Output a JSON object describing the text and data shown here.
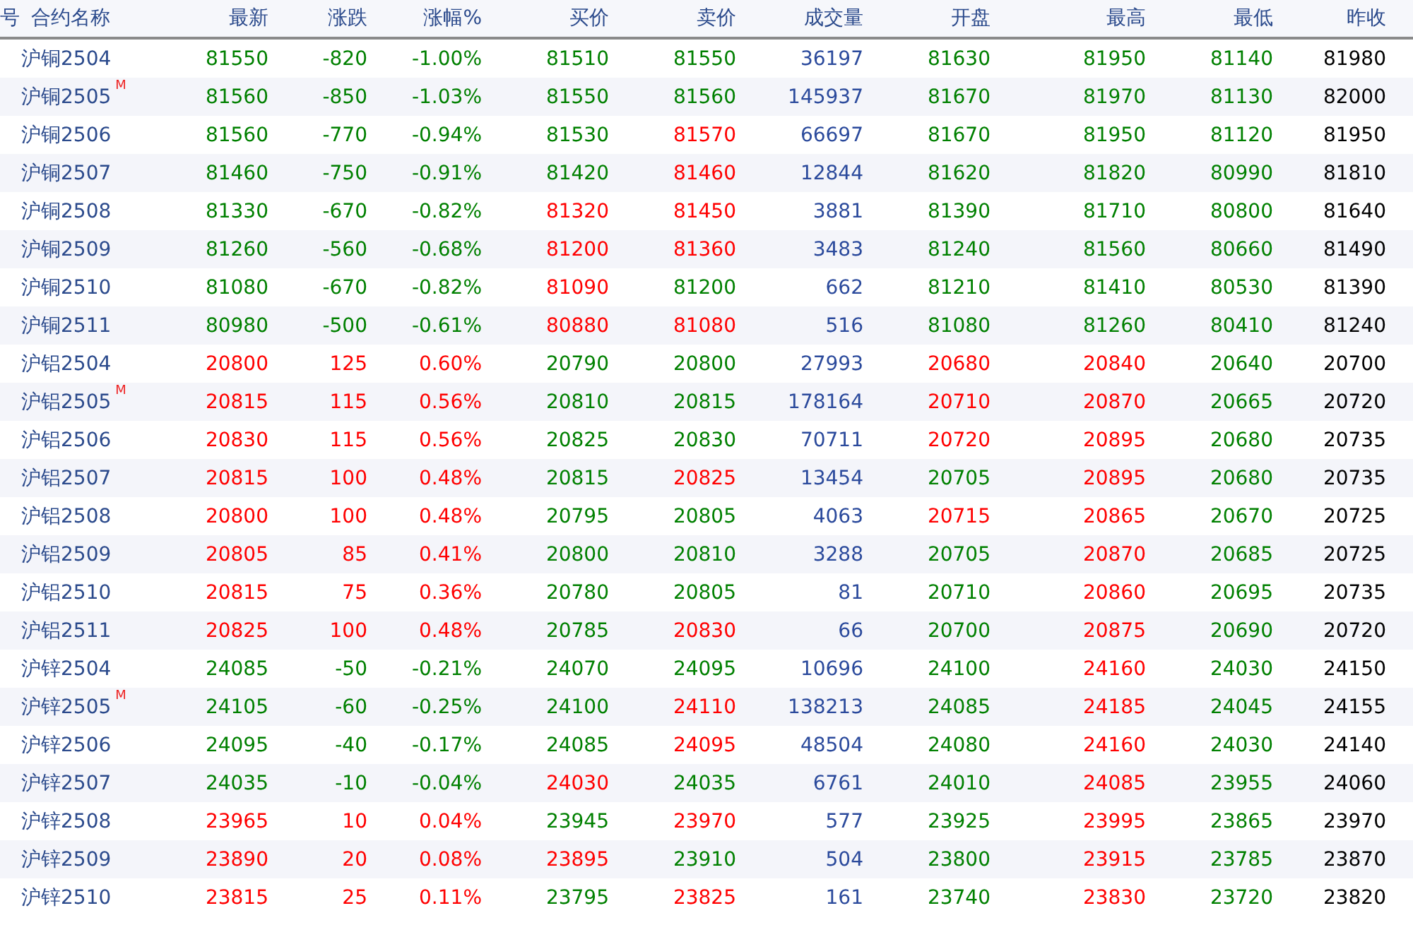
{
  "table": {
    "cut_column_header": "号",
    "columns": [
      "合约名称",
      "最新",
      "涨跌",
      "涨幅%",
      "买价",
      "卖价",
      "成交量",
      "开盘",
      "最高",
      "最低",
      "昨收"
    ],
    "rows": [
      {
        "cells": [
          {
            "text": "沪铜2504"
          },
          {
            "text": "81550",
            "color": "#008000"
          },
          {
            "text": "-820",
            "color": "#008000"
          },
          {
            "text": "-1.00%",
            "color": "#008000"
          },
          {
            "text": "81510",
            "color": "#008000"
          },
          {
            "text": "81550",
            "color": "#008000"
          },
          {
            "text": "36197",
            "color": "#2b4a9c"
          },
          {
            "text": "81630",
            "color": "#008000"
          },
          {
            "text": "81950",
            "color": "#008000"
          },
          {
            "text": "81140",
            "color": "#008000"
          },
          {
            "text": "81980",
            "color": "#000000"
          }
        ]
      },
      {
        "cells": [
          {
            "text": "沪铜2505",
            "flag": "M"
          },
          {
            "text": "81560",
            "color": "#008000"
          },
          {
            "text": "-850",
            "color": "#008000"
          },
          {
            "text": "-1.03%",
            "color": "#008000"
          },
          {
            "text": "81550",
            "color": "#008000"
          },
          {
            "text": "81560",
            "color": "#008000"
          },
          {
            "text": "145937",
            "color": "#2b4a9c"
          },
          {
            "text": "81670",
            "color": "#008000"
          },
          {
            "text": "81970",
            "color": "#008000"
          },
          {
            "text": "81130",
            "color": "#008000"
          },
          {
            "text": "82000",
            "color": "#000000"
          }
        ]
      },
      {
        "cells": [
          {
            "text": "沪铜2506"
          },
          {
            "text": "81560",
            "color": "#008000"
          },
          {
            "text": "-770",
            "color": "#008000"
          },
          {
            "text": "-0.94%",
            "color": "#008000"
          },
          {
            "text": "81530",
            "color": "#008000"
          },
          {
            "text": "81570",
            "color": "#ff0000"
          },
          {
            "text": "66697",
            "color": "#2b4a9c"
          },
          {
            "text": "81670",
            "color": "#008000"
          },
          {
            "text": "81950",
            "color": "#008000"
          },
          {
            "text": "81120",
            "color": "#008000"
          },
          {
            "text": "81950",
            "color": "#000000"
          }
        ]
      },
      {
        "cells": [
          {
            "text": "沪铜2507"
          },
          {
            "text": "81460",
            "color": "#008000"
          },
          {
            "text": "-750",
            "color": "#008000"
          },
          {
            "text": "-0.91%",
            "color": "#008000"
          },
          {
            "text": "81420",
            "color": "#008000"
          },
          {
            "text": "81460",
            "color": "#ff0000"
          },
          {
            "text": "12844",
            "color": "#2b4a9c"
          },
          {
            "text": "81620",
            "color": "#008000"
          },
          {
            "text": "81820",
            "color": "#008000"
          },
          {
            "text": "80990",
            "color": "#008000"
          },
          {
            "text": "81810",
            "color": "#000000"
          }
        ]
      },
      {
        "cells": [
          {
            "text": "沪铜2508"
          },
          {
            "text": "81330",
            "color": "#008000"
          },
          {
            "text": "-670",
            "color": "#008000"
          },
          {
            "text": "-0.82%",
            "color": "#008000"
          },
          {
            "text": "81320",
            "color": "#ff0000"
          },
          {
            "text": "81450",
            "color": "#ff0000"
          },
          {
            "text": "3881",
            "color": "#2b4a9c"
          },
          {
            "text": "81390",
            "color": "#008000"
          },
          {
            "text": "81710",
            "color": "#008000"
          },
          {
            "text": "80800",
            "color": "#008000"
          },
          {
            "text": "81640",
            "color": "#000000"
          }
        ]
      },
      {
        "cells": [
          {
            "text": "沪铜2509"
          },
          {
            "text": "81260",
            "color": "#008000"
          },
          {
            "text": "-560",
            "color": "#008000"
          },
          {
            "text": "-0.68%",
            "color": "#008000"
          },
          {
            "text": "81200",
            "color": "#ff0000"
          },
          {
            "text": "81360",
            "color": "#ff0000"
          },
          {
            "text": "3483",
            "color": "#2b4a9c"
          },
          {
            "text": "81240",
            "color": "#008000"
          },
          {
            "text": "81560",
            "color": "#008000"
          },
          {
            "text": "80660",
            "color": "#008000"
          },
          {
            "text": "81490",
            "color": "#000000"
          }
        ]
      },
      {
        "cells": [
          {
            "text": "沪铜2510"
          },
          {
            "text": "81080",
            "color": "#008000"
          },
          {
            "text": "-670",
            "color": "#008000"
          },
          {
            "text": "-0.82%",
            "color": "#008000"
          },
          {
            "text": "81090",
            "color": "#ff0000"
          },
          {
            "text": "81200",
            "color": "#008000"
          },
          {
            "text": "662",
            "color": "#2b4a9c"
          },
          {
            "text": "81210",
            "color": "#008000"
          },
          {
            "text": "81410",
            "color": "#008000"
          },
          {
            "text": "80530",
            "color": "#008000"
          },
          {
            "text": "81390",
            "color": "#000000"
          }
        ]
      },
      {
        "cells": [
          {
            "text": "沪铜2511"
          },
          {
            "text": "80980",
            "color": "#008000"
          },
          {
            "text": "-500",
            "color": "#008000"
          },
          {
            "text": "-0.61%",
            "color": "#008000"
          },
          {
            "text": "80880",
            "color": "#ff0000"
          },
          {
            "text": "81080",
            "color": "#ff0000"
          },
          {
            "text": "516",
            "color": "#2b4a9c"
          },
          {
            "text": "81080",
            "color": "#008000"
          },
          {
            "text": "81260",
            "color": "#008000"
          },
          {
            "text": "80410",
            "color": "#008000"
          },
          {
            "text": "81240",
            "color": "#000000"
          }
        ]
      },
      {
        "cells": [
          {
            "text": "沪铝2504"
          },
          {
            "text": "20800",
            "color": "#ff0000"
          },
          {
            "text": "125",
            "color": "#ff0000"
          },
          {
            "text": "0.60%",
            "color": "#ff0000"
          },
          {
            "text": "20790",
            "color": "#008000"
          },
          {
            "text": "20800",
            "color": "#008000"
          },
          {
            "text": "27993",
            "color": "#2b4a9c"
          },
          {
            "text": "20680",
            "color": "#ff0000"
          },
          {
            "text": "20840",
            "color": "#ff0000"
          },
          {
            "text": "20640",
            "color": "#008000"
          },
          {
            "text": "20700",
            "color": "#000000"
          }
        ]
      },
      {
        "cells": [
          {
            "text": "沪铝2505",
            "flag": "M"
          },
          {
            "text": "20815",
            "color": "#ff0000"
          },
          {
            "text": "115",
            "color": "#ff0000"
          },
          {
            "text": "0.56%",
            "color": "#ff0000"
          },
          {
            "text": "20810",
            "color": "#008000"
          },
          {
            "text": "20815",
            "color": "#008000"
          },
          {
            "text": "178164",
            "color": "#2b4a9c"
          },
          {
            "text": "20710",
            "color": "#ff0000"
          },
          {
            "text": "20870",
            "color": "#ff0000"
          },
          {
            "text": "20665",
            "color": "#008000"
          },
          {
            "text": "20720",
            "color": "#000000"
          }
        ]
      },
      {
        "cells": [
          {
            "text": "沪铝2506"
          },
          {
            "text": "20830",
            "color": "#ff0000"
          },
          {
            "text": "115",
            "color": "#ff0000"
          },
          {
            "text": "0.56%",
            "color": "#ff0000"
          },
          {
            "text": "20825",
            "color": "#008000"
          },
          {
            "text": "20830",
            "color": "#008000"
          },
          {
            "text": "70711",
            "color": "#2b4a9c"
          },
          {
            "text": "20720",
            "color": "#ff0000"
          },
          {
            "text": "20895",
            "color": "#ff0000"
          },
          {
            "text": "20680",
            "color": "#008000"
          },
          {
            "text": "20735",
            "color": "#000000"
          }
        ]
      },
      {
        "cells": [
          {
            "text": "沪铝2507"
          },
          {
            "text": "20815",
            "color": "#ff0000"
          },
          {
            "text": "100",
            "color": "#ff0000"
          },
          {
            "text": "0.48%",
            "color": "#ff0000"
          },
          {
            "text": "20815",
            "color": "#008000"
          },
          {
            "text": "20825",
            "color": "#ff0000"
          },
          {
            "text": "13454",
            "color": "#2b4a9c"
          },
          {
            "text": "20705",
            "color": "#008000"
          },
          {
            "text": "20895",
            "color": "#ff0000"
          },
          {
            "text": "20680",
            "color": "#008000"
          },
          {
            "text": "20735",
            "color": "#000000"
          }
        ]
      },
      {
        "cells": [
          {
            "text": "沪铝2508"
          },
          {
            "text": "20800",
            "color": "#ff0000"
          },
          {
            "text": "100",
            "color": "#ff0000"
          },
          {
            "text": "0.48%",
            "color": "#ff0000"
          },
          {
            "text": "20795",
            "color": "#008000"
          },
          {
            "text": "20805",
            "color": "#008000"
          },
          {
            "text": "4063",
            "color": "#2b4a9c"
          },
          {
            "text": "20715",
            "color": "#ff0000"
          },
          {
            "text": "20865",
            "color": "#ff0000"
          },
          {
            "text": "20670",
            "color": "#008000"
          },
          {
            "text": "20725",
            "color": "#000000"
          }
        ]
      },
      {
        "cells": [
          {
            "text": "沪铝2509"
          },
          {
            "text": "20805",
            "color": "#ff0000"
          },
          {
            "text": "85",
            "color": "#ff0000"
          },
          {
            "text": "0.41%",
            "color": "#ff0000"
          },
          {
            "text": "20800",
            "color": "#008000"
          },
          {
            "text": "20810",
            "color": "#008000"
          },
          {
            "text": "3288",
            "color": "#2b4a9c"
          },
          {
            "text": "20705",
            "color": "#008000"
          },
          {
            "text": "20870",
            "color": "#ff0000"
          },
          {
            "text": "20685",
            "color": "#008000"
          },
          {
            "text": "20725",
            "color": "#000000"
          }
        ]
      },
      {
        "cells": [
          {
            "text": "沪铝2510"
          },
          {
            "text": "20815",
            "color": "#ff0000"
          },
          {
            "text": "75",
            "color": "#ff0000"
          },
          {
            "text": "0.36%",
            "color": "#ff0000"
          },
          {
            "text": "20780",
            "color": "#008000"
          },
          {
            "text": "20805",
            "color": "#008000"
          },
          {
            "text": "81",
            "color": "#2b4a9c"
          },
          {
            "text": "20710",
            "color": "#008000"
          },
          {
            "text": "20860",
            "color": "#ff0000"
          },
          {
            "text": "20695",
            "color": "#008000"
          },
          {
            "text": "20735",
            "color": "#000000"
          }
        ]
      },
      {
        "cells": [
          {
            "text": "沪铝2511"
          },
          {
            "text": "20825",
            "color": "#ff0000"
          },
          {
            "text": "100",
            "color": "#ff0000"
          },
          {
            "text": "0.48%",
            "color": "#ff0000"
          },
          {
            "text": "20785",
            "color": "#008000"
          },
          {
            "text": "20830",
            "color": "#ff0000"
          },
          {
            "text": "66",
            "color": "#2b4a9c"
          },
          {
            "text": "20700",
            "color": "#008000"
          },
          {
            "text": "20875",
            "color": "#ff0000"
          },
          {
            "text": "20690",
            "color": "#008000"
          },
          {
            "text": "20720",
            "color": "#000000"
          }
        ]
      },
      {
        "cells": [
          {
            "text": "沪锌2504"
          },
          {
            "text": "24085",
            "color": "#008000"
          },
          {
            "text": "-50",
            "color": "#008000"
          },
          {
            "text": "-0.21%",
            "color": "#008000"
          },
          {
            "text": "24070",
            "color": "#008000"
          },
          {
            "text": "24095",
            "color": "#008000"
          },
          {
            "text": "10696",
            "color": "#2b4a9c"
          },
          {
            "text": "24100",
            "color": "#008000"
          },
          {
            "text": "24160",
            "color": "#ff0000"
          },
          {
            "text": "24030",
            "color": "#008000"
          },
          {
            "text": "24150",
            "color": "#000000"
          }
        ]
      },
      {
        "cells": [
          {
            "text": "沪锌2505",
            "flag": "M"
          },
          {
            "text": "24105",
            "color": "#008000"
          },
          {
            "text": "-60",
            "color": "#008000"
          },
          {
            "text": "-0.25%",
            "color": "#008000"
          },
          {
            "text": "24100",
            "color": "#008000"
          },
          {
            "text": "24110",
            "color": "#ff0000"
          },
          {
            "text": "138213",
            "color": "#2b4a9c"
          },
          {
            "text": "24085",
            "color": "#008000"
          },
          {
            "text": "24185",
            "color": "#ff0000"
          },
          {
            "text": "24045",
            "color": "#008000"
          },
          {
            "text": "24155",
            "color": "#000000"
          }
        ]
      },
      {
        "cells": [
          {
            "text": "沪锌2506"
          },
          {
            "text": "24095",
            "color": "#008000"
          },
          {
            "text": "-40",
            "color": "#008000"
          },
          {
            "text": "-0.17%",
            "color": "#008000"
          },
          {
            "text": "24085",
            "color": "#008000"
          },
          {
            "text": "24095",
            "color": "#ff0000"
          },
          {
            "text": "48504",
            "color": "#2b4a9c"
          },
          {
            "text": "24080",
            "color": "#008000"
          },
          {
            "text": "24160",
            "color": "#ff0000"
          },
          {
            "text": "24030",
            "color": "#008000"
          },
          {
            "text": "24140",
            "color": "#000000"
          }
        ]
      },
      {
        "cells": [
          {
            "text": "沪锌2507"
          },
          {
            "text": "24035",
            "color": "#008000"
          },
          {
            "text": "-10",
            "color": "#008000"
          },
          {
            "text": "-0.04%",
            "color": "#008000"
          },
          {
            "text": "24030",
            "color": "#ff0000"
          },
          {
            "text": "24035",
            "color": "#008000"
          },
          {
            "text": "6761",
            "color": "#2b4a9c"
          },
          {
            "text": "24010",
            "color": "#008000"
          },
          {
            "text": "24085",
            "color": "#ff0000"
          },
          {
            "text": "23955",
            "color": "#008000"
          },
          {
            "text": "24060",
            "color": "#000000"
          }
        ]
      },
      {
        "cells": [
          {
            "text": "沪锌2508"
          },
          {
            "text": "23965",
            "color": "#ff0000"
          },
          {
            "text": "10",
            "color": "#ff0000"
          },
          {
            "text": "0.04%",
            "color": "#ff0000"
          },
          {
            "text": "23945",
            "color": "#008000"
          },
          {
            "text": "23970",
            "color": "#ff0000"
          },
          {
            "text": "577",
            "color": "#2b4a9c"
          },
          {
            "text": "23925",
            "color": "#008000"
          },
          {
            "text": "23995",
            "color": "#ff0000"
          },
          {
            "text": "23865",
            "color": "#008000"
          },
          {
            "text": "23970",
            "color": "#000000"
          }
        ]
      },
      {
        "cells": [
          {
            "text": "沪锌2509"
          },
          {
            "text": "23890",
            "color": "#ff0000"
          },
          {
            "text": "20",
            "color": "#ff0000"
          },
          {
            "text": "0.08%",
            "color": "#ff0000"
          },
          {
            "text": "23895",
            "color": "#ff0000"
          },
          {
            "text": "23910",
            "color": "#008000"
          },
          {
            "text": "504",
            "color": "#2b4a9c"
          },
          {
            "text": "23800",
            "color": "#008000"
          },
          {
            "text": "23915",
            "color": "#ff0000"
          },
          {
            "text": "23785",
            "color": "#008000"
          },
          {
            "text": "23870",
            "color": "#000000"
          }
        ]
      },
      {
        "cells": [
          {
            "text": "沪锌2510"
          },
          {
            "text": "23815",
            "color": "#ff0000"
          },
          {
            "text": "25",
            "color": "#ff0000"
          },
          {
            "text": "0.11%",
            "color": "#ff0000"
          },
          {
            "text": "23795",
            "color": "#008000"
          },
          {
            "text": "23825",
            "color": "#ff0000"
          },
          {
            "text": "161",
            "color": "#2b4a9c"
          },
          {
            "text": "23740",
            "color": "#008000"
          },
          {
            "text": "23830",
            "color": "#ff0000"
          },
          {
            "text": "23720",
            "color": "#008000"
          },
          {
            "text": "23820",
            "color": "#000000"
          }
        ]
      }
    ]
  }
}
